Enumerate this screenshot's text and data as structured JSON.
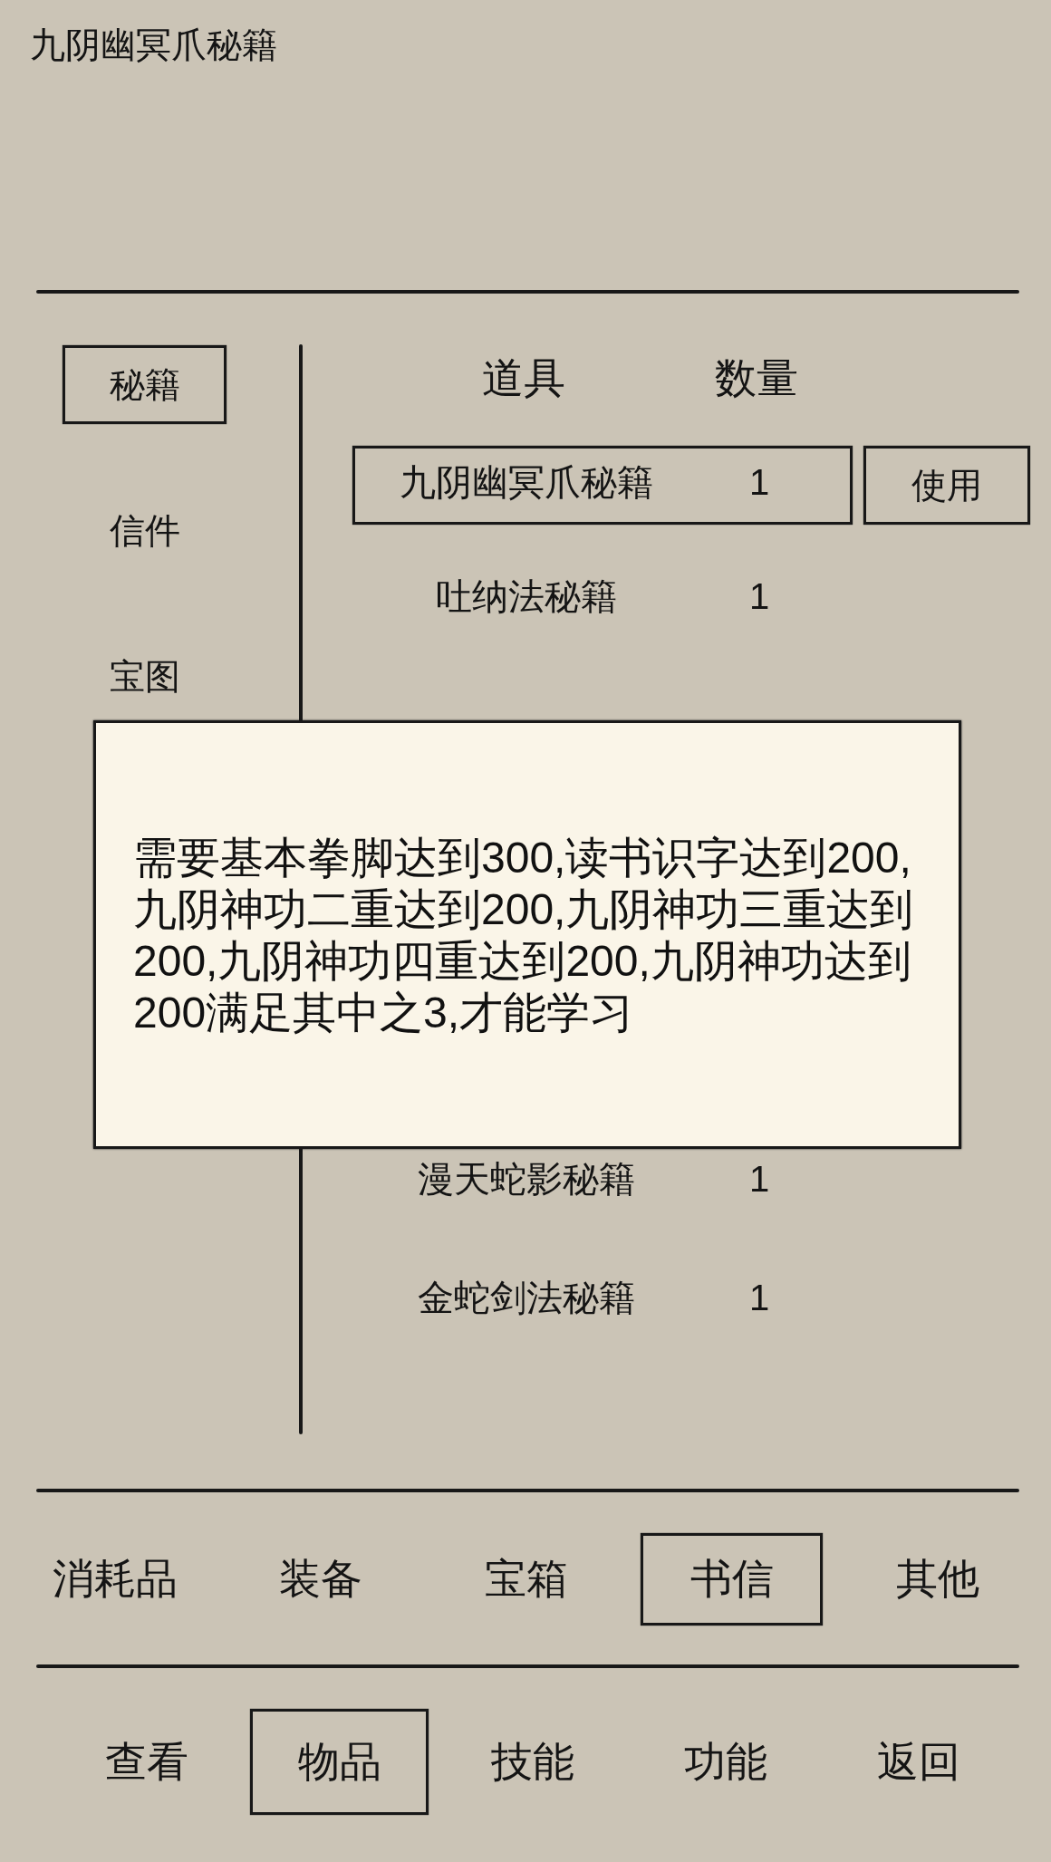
{
  "title": "九阴幽冥爪秘籍",
  "sidebar": {
    "items": [
      {
        "label": "秘籍",
        "selected": true
      },
      {
        "label": "信件",
        "selected": false
      },
      {
        "label": "宝图",
        "selected": false
      }
    ]
  },
  "table": {
    "columns": [
      "道具",
      "数量"
    ],
    "use_button": "使用",
    "rows_above_dialog": [
      {
        "name": "九阴幽冥爪秘籍",
        "quantity": "1",
        "selected": true
      },
      {
        "name": "吐纳法秘籍",
        "quantity": "1",
        "selected": false
      }
    ],
    "rows_below_dialog": [
      {
        "name": "漫天蛇影秘籍",
        "quantity": "1",
        "selected": false
      },
      {
        "name": "金蛇剑法秘籍",
        "quantity": "1",
        "selected": false
      }
    ]
  },
  "dialog": {
    "text": "需要基本拳脚达到300,读书识字达到200,九阴神功二重达到200,九阴神功三重达到200,九阴神功四重达到200,九阴神功达到200满足其中之3,才能学习"
  },
  "category_tabs": [
    {
      "label": "消耗品",
      "selected": false
    },
    {
      "label": "装备",
      "selected": false
    },
    {
      "label": "宝箱",
      "selected": false
    },
    {
      "label": "书信",
      "selected": true
    },
    {
      "label": "其他",
      "selected": false
    }
  ],
  "nav": [
    {
      "label": "查看",
      "selected": false
    },
    {
      "label": "物品",
      "selected": true
    },
    {
      "label": "技能",
      "selected": false
    },
    {
      "label": "功能",
      "selected": false
    },
    {
      "label": "返回",
      "selected": false
    }
  ]
}
